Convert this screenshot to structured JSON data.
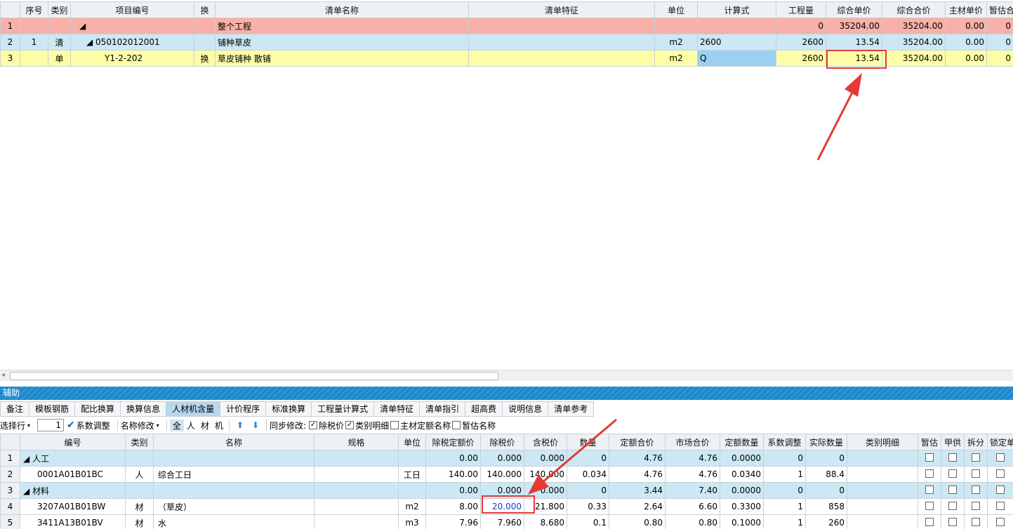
{
  "top_grid": {
    "headers": [
      "序号",
      "类别",
      "项目编号",
      "换",
      "清单名称",
      "清单特征",
      "单位",
      "计算式",
      "工程量",
      "综合单价",
      "综合合价",
      "主材单价",
      "暂估合"
    ],
    "rows": [
      {
        "rn": "1",
        "seq": "",
        "type": "",
        "code": "◢",
        "huan": "",
        "name": "整个工程",
        "feature": "",
        "unit": "",
        "formula": "",
        "qty": "0",
        "unit_price": "35204.00",
        "total": "35204.00",
        "main_price": "0.00",
        "est": "0"
      },
      {
        "rn": "2",
        "seq": "1",
        "type": "清",
        "code": "◢ 050102012001",
        "huan": "",
        "name": "铺种草皮",
        "feature": "",
        "unit": "m2",
        "formula": "2600",
        "qty": "2600",
        "unit_price": "13.54",
        "total": "35204.00",
        "main_price": "0.00",
        "est": "0"
      },
      {
        "rn": "3",
        "seq": "",
        "type": "单",
        "code": "Y1-2-202",
        "huan": "换",
        "name": "草皮铺种 散铺",
        "feature": "",
        "unit": "m2",
        "formula": "Q",
        "qty": "2600",
        "unit_price": "13.54",
        "total": "35204.00",
        "main_price": "0.00",
        "est": "0"
      }
    ]
  },
  "help_bar": {
    "title": "辅助"
  },
  "tabs": [
    "备注",
    "模板钢筋",
    "配比换算",
    "换算信息",
    "人材机含量",
    "计价程序",
    "标准换算",
    "工程量计算式",
    "清单特征",
    "清单指引",
    "超高费",
    "说明信息",
    "清单参考"
  ],
  "active_tab": "人材机含量",
  "toolbar": {
    "select_row": "选择行",
    "row_num": "1",
    "coef_adjust": "系数调整",
    "rename": "名称修改",
    "filters": [
      "全",
      "人",
      "材",
      "机"
    ],
    "sync_label": "同步修改:",
    "opt_tax": "除税价",
    "opt_detail": "类别明细",
    "opt_main": "主材定额名称",
    "opt_est": "暂估名称"
  },
  "bottom_grid": {
    "headers": [
      "编号",
      "类别",
      "名称",
      "规格",
      "单位",
      "除税定额价",
      "除税价",
      "含税价",
      "数量",
      "定额合价",
      "市场合价",
      "定额数量",
      "系数调整",
      "实际数量",
      "类别明细",
      "暂估",
      "甲供",
      "拆分",
      "锁定单"
    ],
    "rows": [
      {
        "rn": "1",
        "code": "◢ 人工",
        "type": "",
        "name": "",
        "spec": "",
        "unit": "",
        "base_price": "0.00",
        "tax_ex": "0.000",
        "tax_in": "0.000",
        "num": "0",
        "base_total": "4.76",
        "market_total": "4.76",
        "base_qty": "0.0000",
        "coef": "0",
        "actual": "0",
        "detail": "",
        "group": true
      },
      {
        "rn": "2",
        "code": "0001A01B01BC",
        "type": "人",
        "name": "综合工日",
        "spec": "",
        "unit": "工日",
        "base_price": "140.00",
        "tax_ex": "140.000",
        "tax_in": "140.000",
        "num": "0.034",
        "base_total": "4.76",
        "market_total": "4.76",
        "base_qty": "0.0340",
        "coef": "1",
        "actual": "88.4",
        "detail": "",
        "group": false
      },
      {
        "rn": "3",
        "code": "◢ 材料",
        "type": "",
        "name": "",
        "spec": "",
        "unit": "",
        "base_price": "0.00",
        "tax_ex": "0.000",
        "tax_in": "0.000",
        "num": "0",
        "base_total": "3.44",
        "market_total": "7.40",
        "base_qty": "0.0000",
        "coef": "0",
        "actual": "0",
        "detail": "",
        "group": true
      },
      {
        "rn": "4",
        "code": "3207A01B01BW",
        "type": "材",
        "name": "（草皮）",
        "spec": "",
        "unit": "m2",
        "base_price": "8.00",
        "tax_ex": "20.000",
        "tax_in": "21.800",
        "num": "0.33",
        "base_total": "2.64",
        "market_total": "6.60",
        "base_qty": "0.3300",
        "coef": "1",
        "actual": "858",
        "detail": "",
        "group": false
      },
      {
        "rn": "5",
        "code": "3411A13B01BV",
        "type": "材",
        "name": "水",
        "spec": "",
        "unit": "m3",
        "base_price": "7.96",
        "tax_ex": "7.960",
        "tax_in": "8.680",
        "num": "0.1",
        "base_total": "0.80",
        "market_total": "0.80",
        "base_qty": "0.1000",
        "coef": "1",
        "actual": "260",
        "detail": "",
        "group": false
      }
    ]
  },
  "colors": {
    "pink": "#f8b0a8",
    "blue": "#cce8f4",
    "yellow": "#fdfda8",
    "highlight": "#e53935",
    "accent": "#1d86c8"
  }
}
